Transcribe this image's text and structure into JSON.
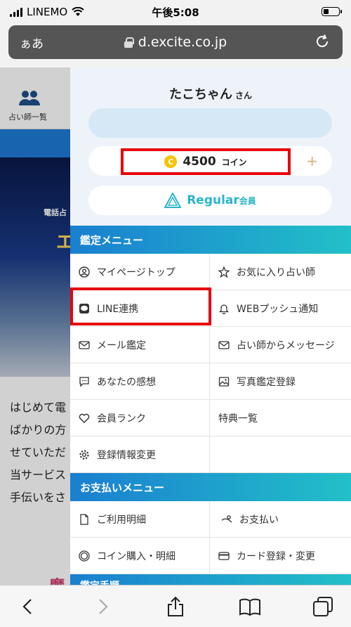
{
  "status": {
    "carrier": "LINEMO",
    "time": "午後5:08"
  },
  "browser": {
    "aa_label": "ぁあ",
    "domain": "d.excite.co.jp"
  },
  "background": {
    "nav_label": "占い師一覧",
    "hero_small": "電話占",
    "hero_big": "エ",
    "text_lines": [
      "はじめて電",
      "ばかりの方",
      "せていただ",
      "当サービス",
      "手伝いをさ"
    ],
    "peek": "魔"
  },
  "profile": {
    "name": "たこちゃん",
    "honorific": "さん",
    "coin_amount": "4500",
    "coin_unit": "コイン",
    "coin_symbol": "C",
    "plus": "+",
    "member_rank": "Regular",
    "member_suffix": "会員"
  },
  "menu": {
    "title": "鑑定メニュー",
    "items": [
      {
        "label": "マイページトップ",
        "icon": "user-circle-icon"
      },
      {
        "label": "お気に入り占い師",
        "icon": "star-icon"
      },
      {
        "label": "LINE連携",
        "icon": "line-icon"
      },
      {
        "label": "WEBプッシュ通知",
        "icon": "bell-icon"
      },
      {
        "label": "メール鑑定",
        "icon": "mail-icon"
      },
      {
        "label": "占い師からメッセージ",
        "icon": "mail-icon"
      },
      {
        "label": "あなたの感想",
        "icon": "comment-icon"
      },
      {
        "label": "写真鑑定登録",
        "icon": "photo-icon"
      },
      {
        "label": "会員ランク",
        "icon": "heart-icon"
      },
      {
        "label": "特典一覧",
        "icon": ""
      },
      {
        "label": "登録情報変更",
        "icon": "gear-icon"
      }
    ]
  },
  "payment": {
    "title": "お支払いメニュー",
    "items": [
      {
        "label": "ご利用明細",
        "icon": "document-icon"
      },
      {
        "label": "お支払い",
        "icon": "hand-pay-icon"
      },
      {
        "label": "コイン購入・明細",
        "icon": "coin-icon"
      },
      {
        "label": "カード登録・変更",
        "icon": "card-icon"
      }
    ]
  },
  "peek_section": "鑑定手順",
  "colors": {
    "accent": "#1a7fd0",
    "highlight": "#e8000b",
    "coin": "#f5c400",
    "regular": "#2bb5c8"
  }
}
